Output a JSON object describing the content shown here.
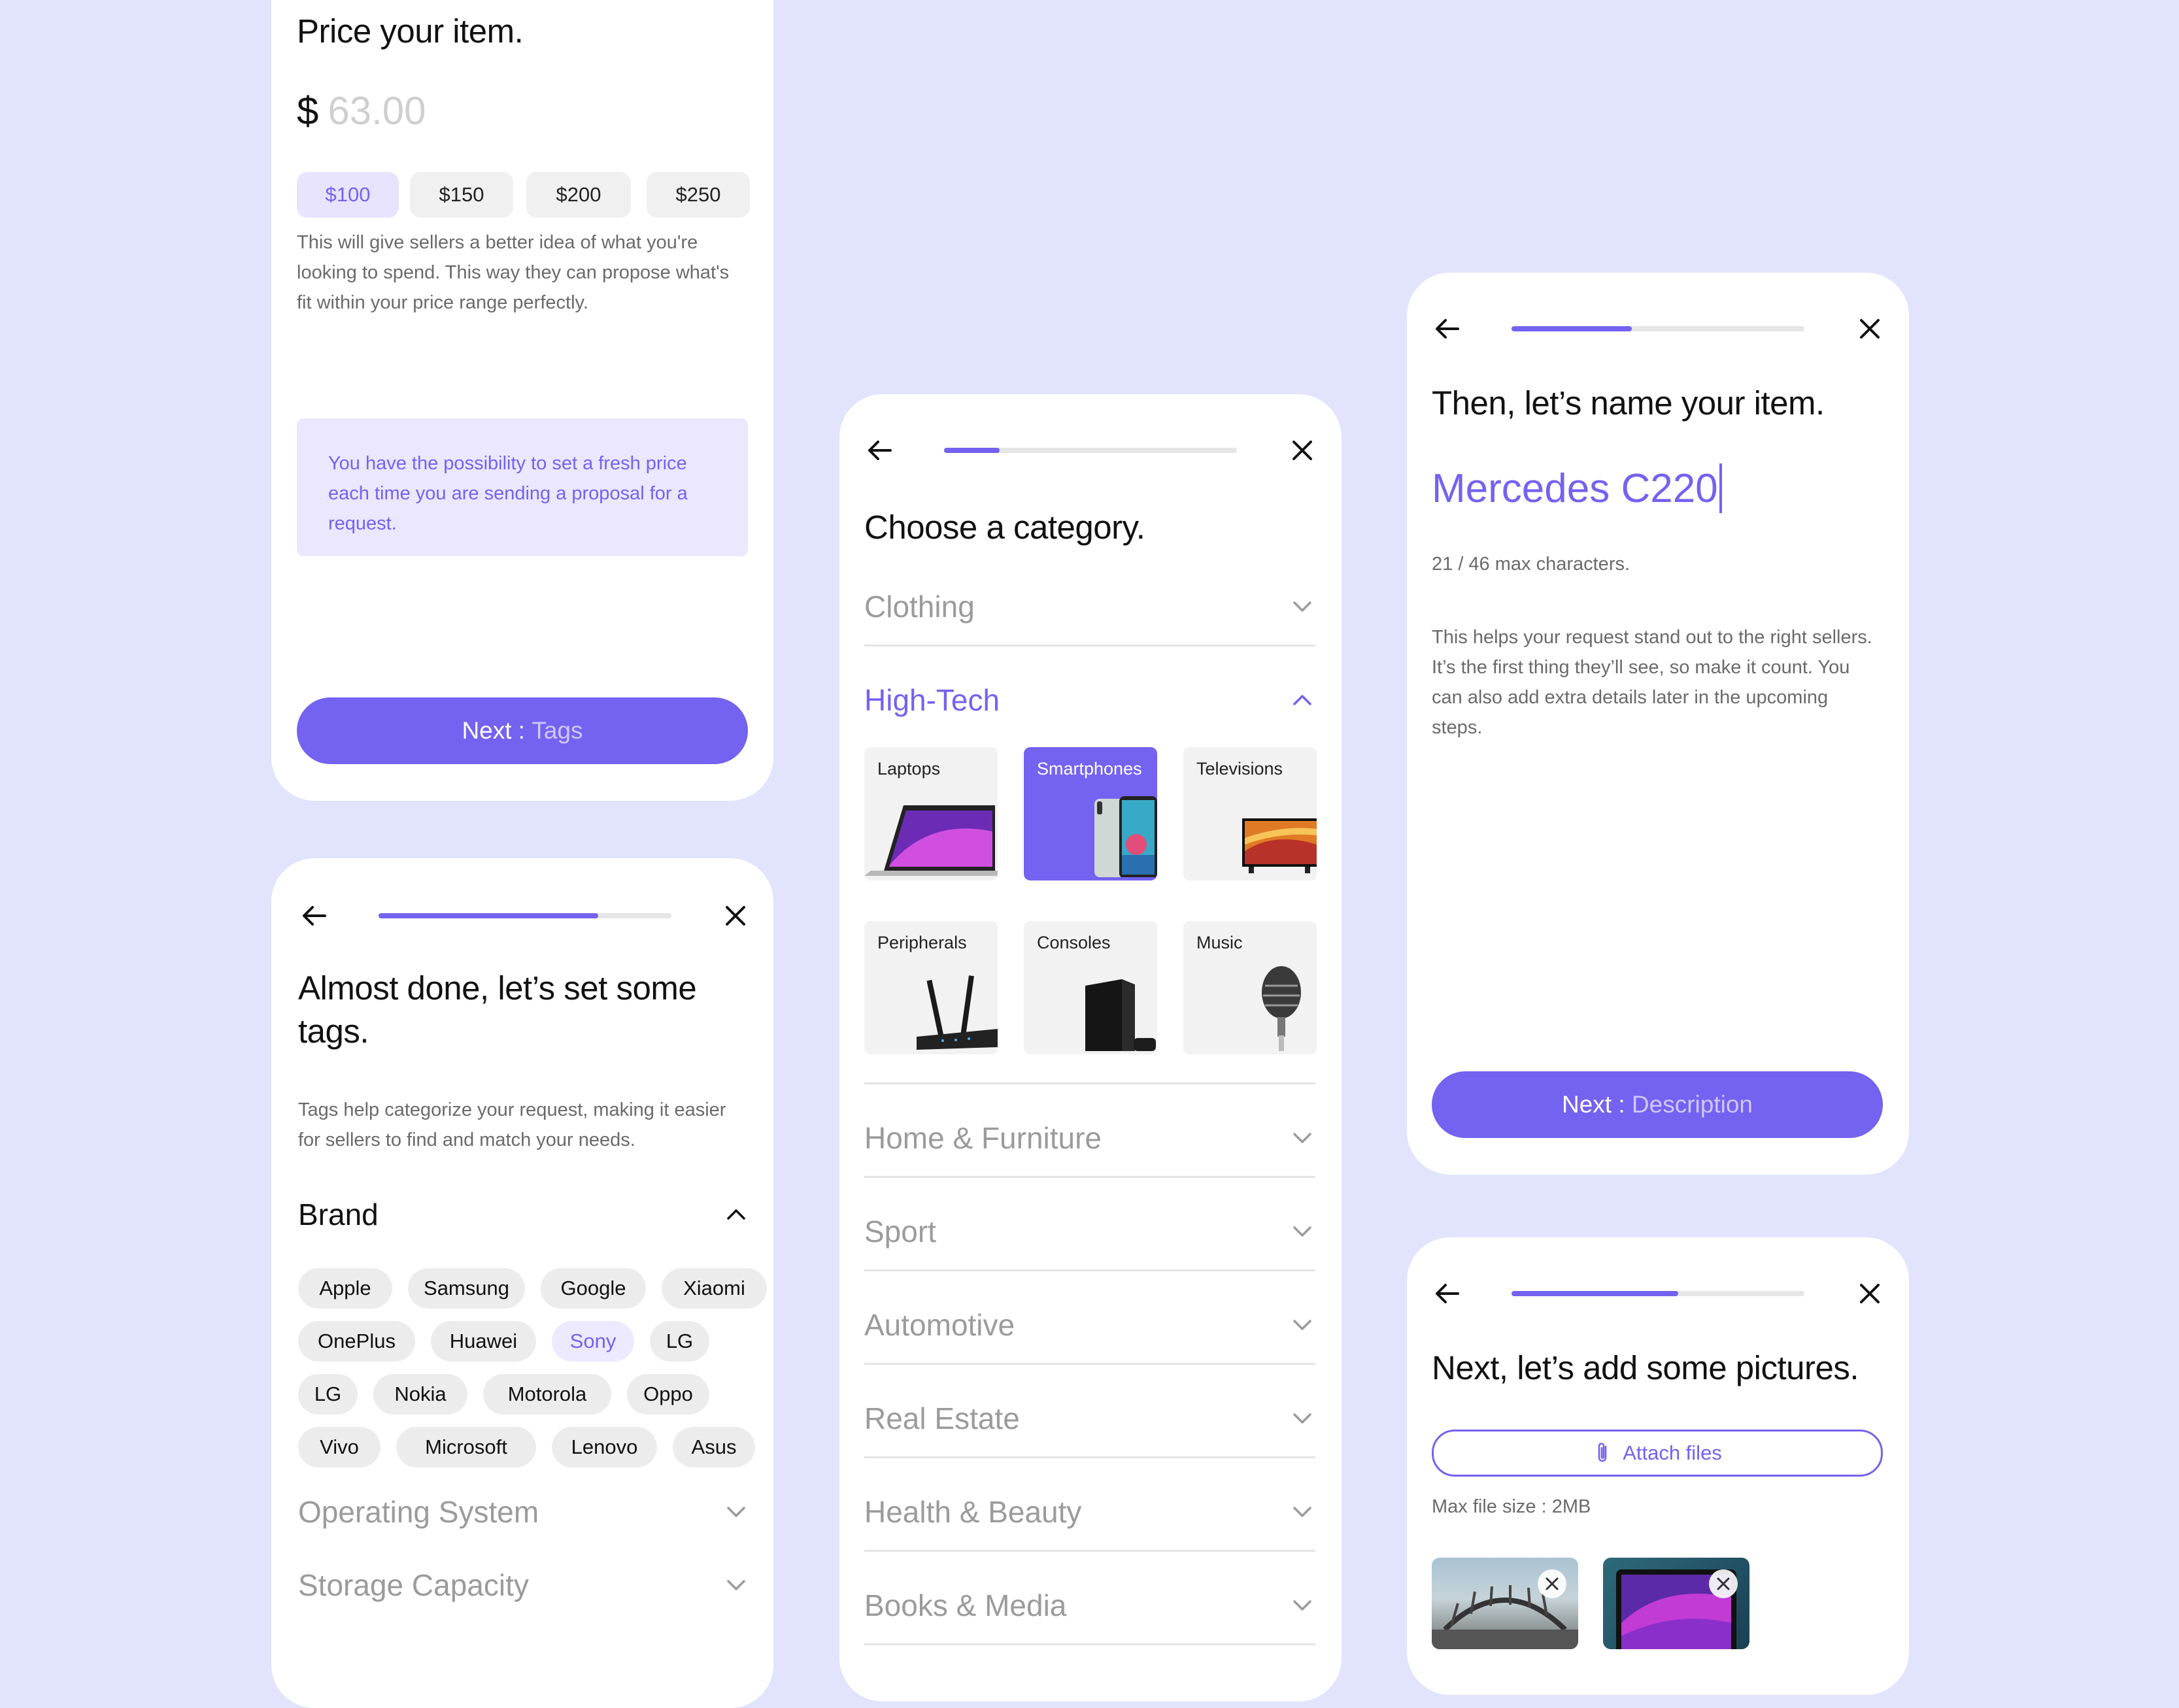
{
  "price_card": {
    "title": "Price your item.",
    "currency": "$",
    "price_placeholder": "63.00",
    "chips": [
      {
        "label": "$100",
        "selected": true
      },
      {
        "label": "$150",
        "selected": false
      },
      {
        "label": "$200",
        "selected": false
      },
      {
        "label": "$250",
        "selected": false
      }
    ],
    "description": "This will give sellers a better idea of what you're looking to spend. This way they can propose what's fit within your price range perfectly.",
    "note": "You have the possibility to set a fresh price each time you are sending a proposal for a request.",
    "next_prefix": "Next :",
    "next_target": "Tags"
  },
  "tags_card": {
    "progress": 0.75,
    "title": "Almost done, let’s set some tags.",
    "description": "Tags help categorize your request, making it easier for sellers to find and match your needs.",
    "brand_heading": "Brand",
    "brand_tags": [
      {
        "label": "Apple",
        "selected": false
      },
      {
        "label": "Samsung",
        "selected": false
      },
      {
        "label": "Google",
        "selected": false
      },
      {
        "label": "Xiaomi",
        "selected": false
      },
      {
        "label": "OnePlus",
        "selected": false
      },
      {
        "label": "Huawei",
        "selected": false
      },
      {
        "label": "Sony",
        "selected": true
      },
      {
        "label": "LG",
        "selected": false
      },
      {
        "label": "LG",
        "selected": false
      },
      {
        "label": "Nokia",
        "selected": false
      },
      {
        "label": "Motorola",
        "selected": false
      },
      {
        "label": "Oppo",
        "selected": false
      },
      {
        "label": "Vivo",
        "selected": false
      },
      {
        "label": "Microsoft",
        "selected": false
      },
      {
        "label": "Lenovo",
        "selected": false
      },
      {
        "label": "Asus",
        "selected": false
      }
    ],
    "collapsed_sections": [
      "Operating System",
      "Storage Capacity"
    ]
  },
  "category_card": {
    "progress": 0.19,
    "title": "Choose a category.",
    "sections_before": [
      "Clothing"
    ],
    "active_section": "High-Tech",
    "tiles": [
      {
        "label": "Laptops",
        "icon": "laptop-image",
        "selected": false
      },
      {
        "label": "Smartphones",
        "icon": "smartphone-image",
        "selected": true
      },
      {
        "label": "Televisions",
        "icon": "television-image",
        "selected": false
      },
      {
        "label": "Peripherals",
        "icon": "router-image",
        "selected": false
      },
      {
        "label": "Consoles",
        "icon": "console-image",
        "selected": false
      },
      {
        "label": "Music",
        "icon": "microphone-image",
        "selected": false
      }
    ],
    "sections_after": [
      "Home & Furniture",
      "Sport",
      "Automotive",
      "Real Estate",
      "Health & Beauty",
      "Books & Media"
    ]
  },
  "name_card": {
    "progress": 0.41,
    "title": "Then, let’s name your item.",
    "item_name": "Mercedes C220",
    "char_count": "21 / 46 max characters.",
    "description": "This helps your request stand out to the right sellers. It’s the first thing they’ll see, so make it count. You can also add extra details later in the upcoming steps.",
    "next_prefix": "Next :",
    "next_target": "Description"
  },
  "pictures_card": {
    "progress": 0.57,
    "title": "Next, let’s add some pictures.",
    "attach_label": "Attach files",
    "max_size": "Max file size : 2MB",
    "thumbnails": [
      "bridge-photo",
      "laptop-photo"
    ]
  },
  "colors": {
    "background": "#e1e4fc",
    "accent": "#7462f0",
    "accent_light": "#ede9ff"
  }
}
